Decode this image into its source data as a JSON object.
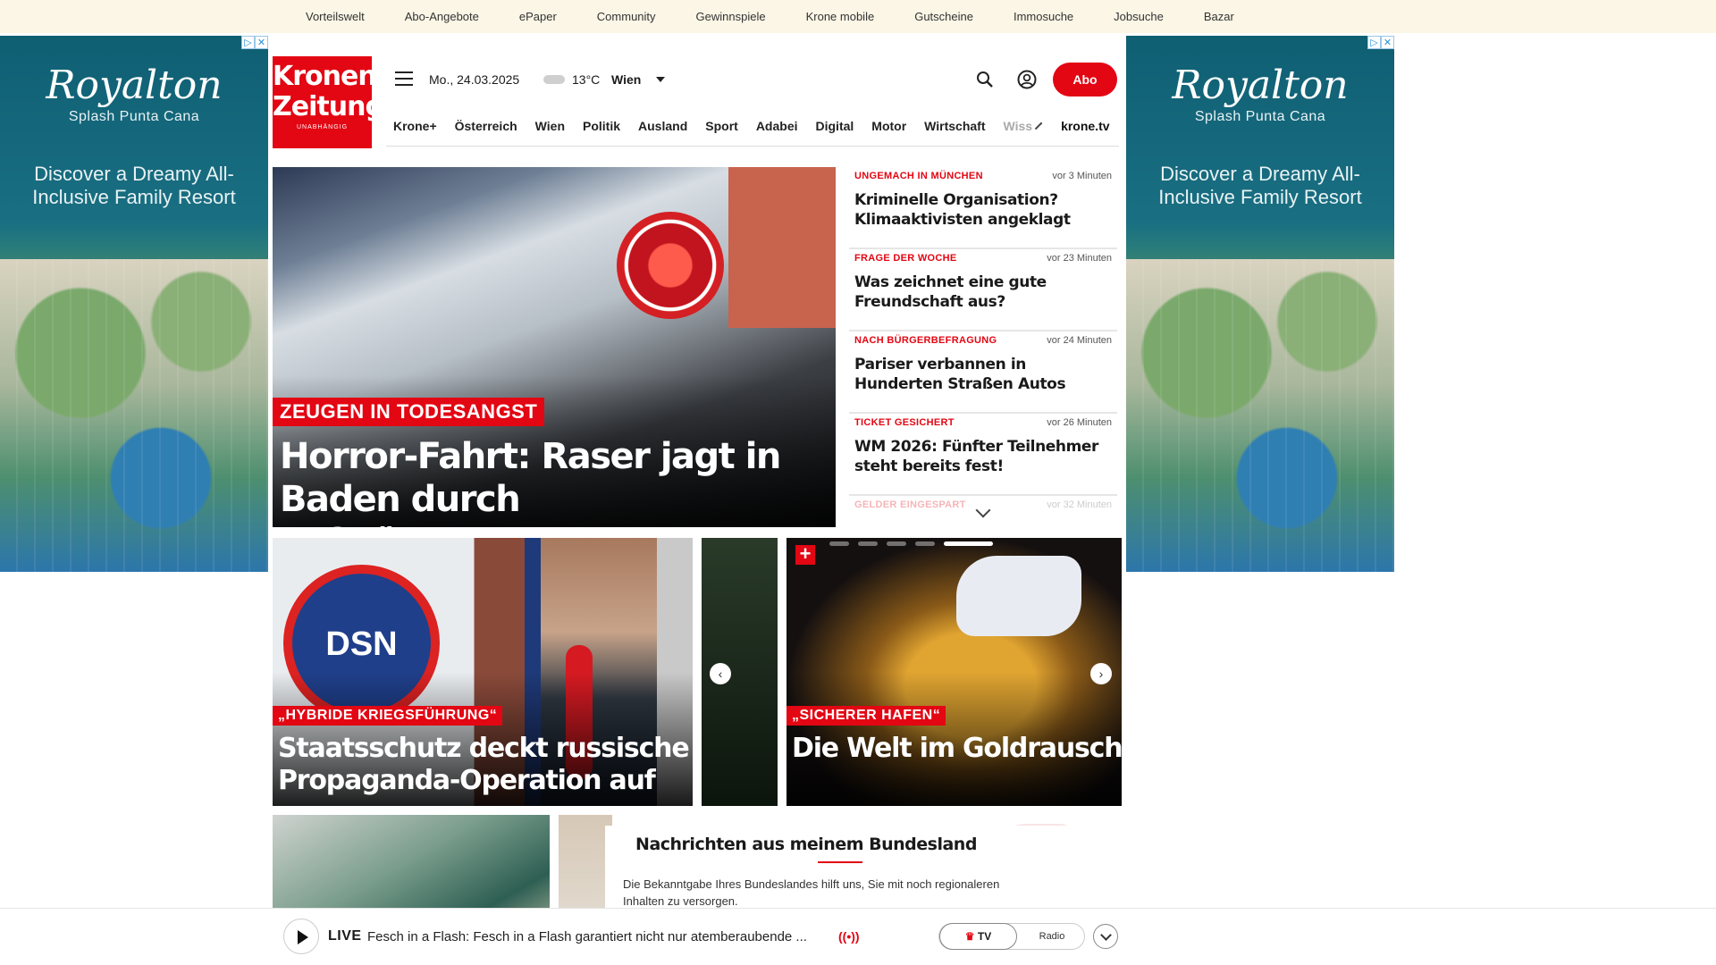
{
  "topnav": [
    "Vorteilswelt",
    "Abo-Angebote",
    "ePaper",
    "Community",
    "Gewinnspiele",
    "Krone mobile",
    "Gutscheine",
    "Immosuche",
    "Jobsuche",
    "Bazar"
  ],
  "ad": {
    "brand": "Royalton",
    "sub": "Splash Punta Cana",
    "tagline": "Discover a Dreamy All-Inclusive Family Resort"
  },
  "header": {
    "logo_line1": "Kronen",
    "logo_line2": "Zeitung",
    "logo_claim": "UNABHÄNGIG",
    "date": "Mo., 24.03.2025",
    "temperature": "13°C",
    "city": "Wien",
    "abo_label": "Abo"
  },
  "nav": [
    "Krone+",
    "Österreich",
    "Wien",
    "Politik",
    "Ausland",
    "Sport",
    "Adabei",
    "Digital",
    "Motor",
    "Wirtschaft"
  ],
  "nav_faded": "Wiss",
  "nav_tv": "krone.tv",
  "hero": {
    "kicker": "ZEUGEN IN TODESANGST",
    "headline": "Horror-Fahrt: Raser jagt in Baden durch Fußgängerzone"
  },
  "ticker": [
    {
      "kicker": "UNGEMACH IN MÜNCHEN",
      "time": "vor 3 Minuten",
      "title": "Kriminelle Organisation? Klimaaktivisten angeklagt"
    },
    {
      "kicker": "FRAGE DER WOCHE",
      "time": "vor 23 Minuten",
      "title": "Was zeichnet eine gute Freundschaft aus?"
    },
    {
      "kicker": "NACH BÜRGERBEFRAGUNG",
      "time": "vor 24 Minuten",
      "title": "Pariser verbannen in Hunderten Straßen Autos"
    },
    {
      "kicker": "TICKET GESICHERT",
      "time": "vor 26 Minuten",
      "title": "WM 2026: Fünfter Teilnehmer steht bereits fest!"
    },
    {
      "kicker": "GELDER EINGESPART",
      "time": "vor 32 Minuten",
      "title": ""
    }
  ],
  "carousel": [
    {
      "kicker": "„HYBRIDE KRIEGSFÜHRUNG“",
      "headline": "Staatsschutz deckt russische Propaganda-Operation auf",
      "seal": "DSN"
    },
    {
      "kicker": "„SICHERER HAFEN“",
      "headline": "Die Welt im Goldrausch: Edelmetall auf Rekordhoc"
    }
  ],
  "bundesland": {
    "title": "Nachrichten aus meinem Bundesland",
    "text": "Die Bekanntgabe Ihres Bundeslandes hilft uns, Sie mit noch regionaleren Inhalten zu versorgen."
  },
  "live": {
    "label": "LIVE",
    "text": "Fesch in a Flash: Fesch in a Flash garantiert nicht nur atemberaubende ...",
    "radio_icon": "((•))",
    "tv_label": "TV",
    "radio_label": "Radio"
  },
  "colors": {
    "accent": "#e30613",
    "topbar": "#fbf6e6"
  }
}
